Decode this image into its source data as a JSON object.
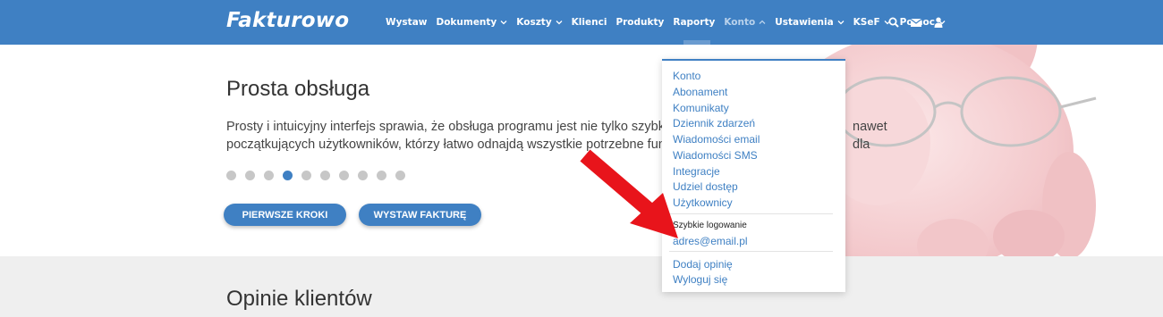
{
  "brand": {
    "logo": "Fakturowo"
  },
  "nav": {
    "items": [
      {
        "label": "Wystaw",
        "dropdown": false
      },
      {
        "label": "Dokumenty",
        "dropdown": true
      },
      {
        "label": "Koszty",
        "dropdown": true
      },
      {
        "label": "Klienci",
        "dropdown": false
      },
      {
        "label": "Produkty",
        "dropdown": false
      },
      {
        "label": "Raporty",
        "dropdown": false
      },
      {
        "label": "Konto",
        "dropdown": true,
        "active": true
      },
      {
        "label": "Ustawienia",
        "dropdown": true
      },
      {
        "label": "KSeF",
        "dropdown": true
      },
      {
        "label": "Pomoc",
        "dropdown": true
      }
    ],
    "icons": [
      "search-icon",
      "envelope-icon",
      "user-icon"
    ]
  },
  "hero": {
    "title": "Prosta obsługa",
    "text": "Prosty i intuicyjny interfejs sprawia, że obsługa programu jest nie tylko szybka i bezpr",
    "text_right": "nawet dla",
    "text_line2": "początkujących użytkowników, którzy łatwo odnajdą wszystkie potrzebne funkcje!",
    "slide_count": 10,
    "active_slide": 4,
    "buttons": {
      "first": "PIERWSZE KROKI",
      "second": "WYSTAW FAKTURĘ"
    }
  },
  "opinie": {
    "title": "Opinie klientów"
  },
  "dropdown": {
    "items": [
      "Konto",
      "Abonament",
      "Komunikaty",
      "Dziennik zdarzeń",
      "Wiadomości email",
      "Wiadomości SMS",
      "Integracje",
      "Udziel dostęp",
      "Użytkownicy"
    ],
    "quick_login_header": "Szybkie logowanie",
    "quick_login_email": "adres@email.pl",
    "footer_items": [
      "Dodaj opinię",
      "Wyloguj się"
    ]
  },
  "colors": {
    "primary": "#3f80c3",
    "arrow": "#e8141b",
    "section_gray": "#efefef"
  }
}
